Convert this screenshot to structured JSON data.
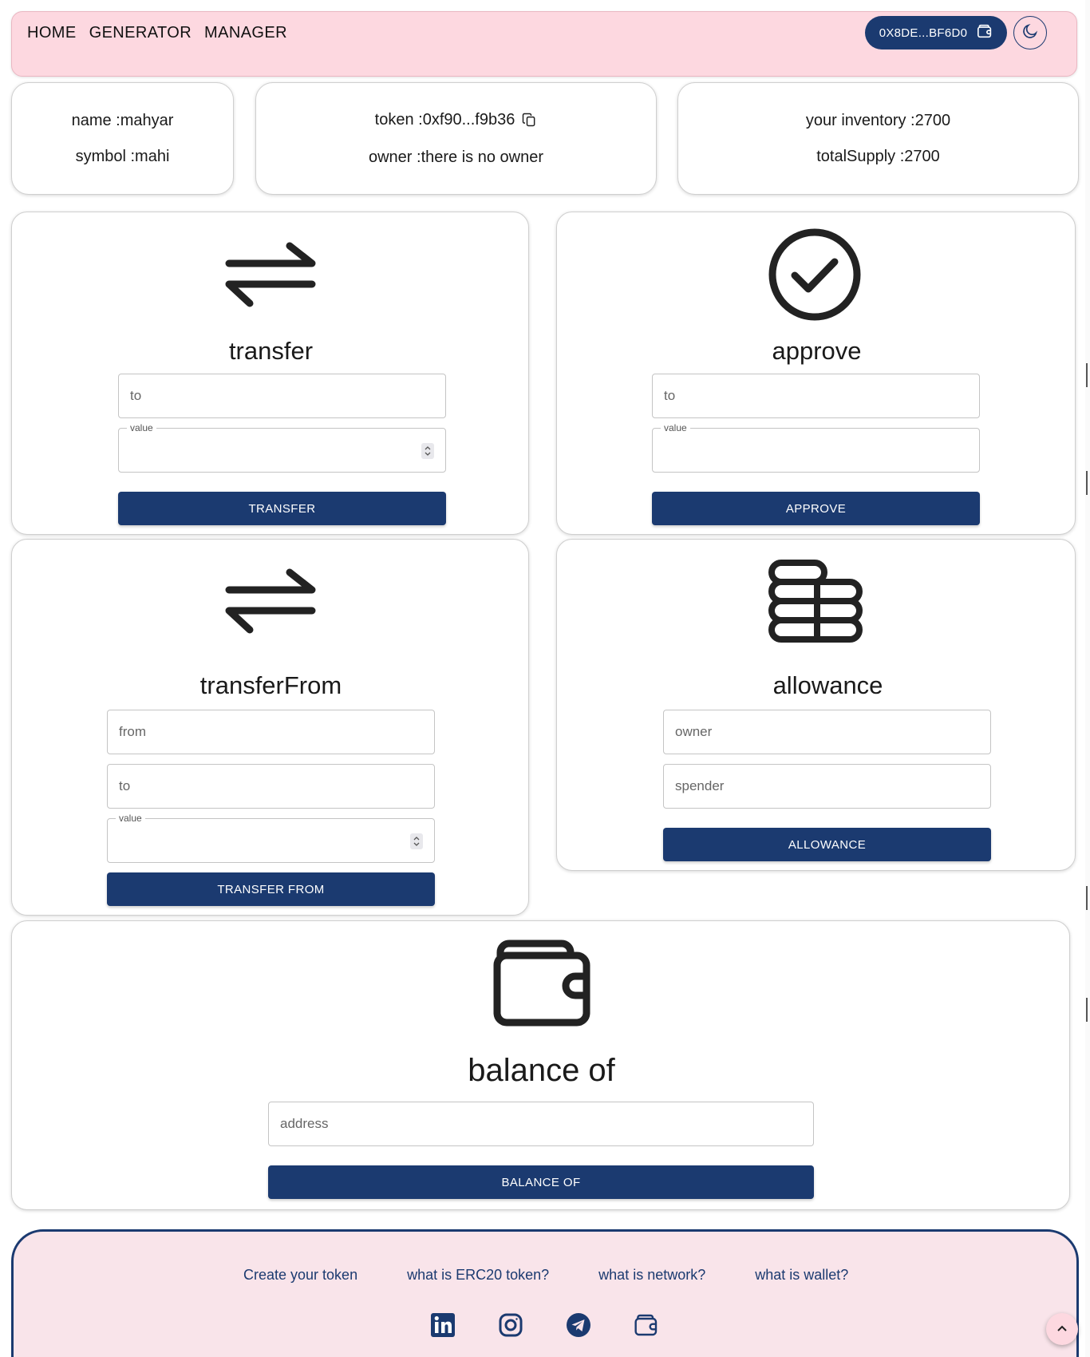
{
  "header": {
    "nav": [
      "HOME",
      "GENERATOR",
      "MANAGER"
    ],
    "wallet_label": "0X8DE...BF6D0"
  },
  "info": {
    "name": "name :mahyar",
    "symbol": "symbol :mahi",
    "token": "token :0xf90...f9b36",
    "owner": "owner :there is no owner",
    "inventory": "your inventory :2700",
    "total_supply": "totalSupply :2700"
  },
  "transfer": {
    "title": "transfer",
    "to_placeholder": "to",
    "value_legend": "value",
    "button": "TRANSFER"
  },
  "approve": {
    "title": "approve",
    "to_placeholder": "to",
    "value_legend": "value",
    "button": "APPROVE"
  },
  "transfer_from": {
    "title": "transferFrom",
    "from_placeholder": "from",
    "to_placeholder": "to",
    "value_legend": "value",
    "button": "TRANSFER FROM"
  },
  "allowance": {
    "title": "allowance",
    "owner_placeholder": "owner",
    "spender_placeholder": "spender",
    "button": "ALLOWANCE"
  },
  "balance_of": {
    "title": "balance of",
    "address_placeholder": "address",
    "button": "BALANCE OF"
  },
  "footer": {
    "links": [
      "Create your token",
      "what is ERC20 token?",
      "what is network?",
      "what is wallet?"
    ],
    "socials": [
      "linkedin-icon",
      "instagram-icon",
      "telegram-icon",
      "wallet-icon"
    ]
  },
  "colors": {
    "primary": "#1b3a70",
    "header_bg": "#fdd8e0",
    "footer_bg": "#f9e4ea"
  }
}
